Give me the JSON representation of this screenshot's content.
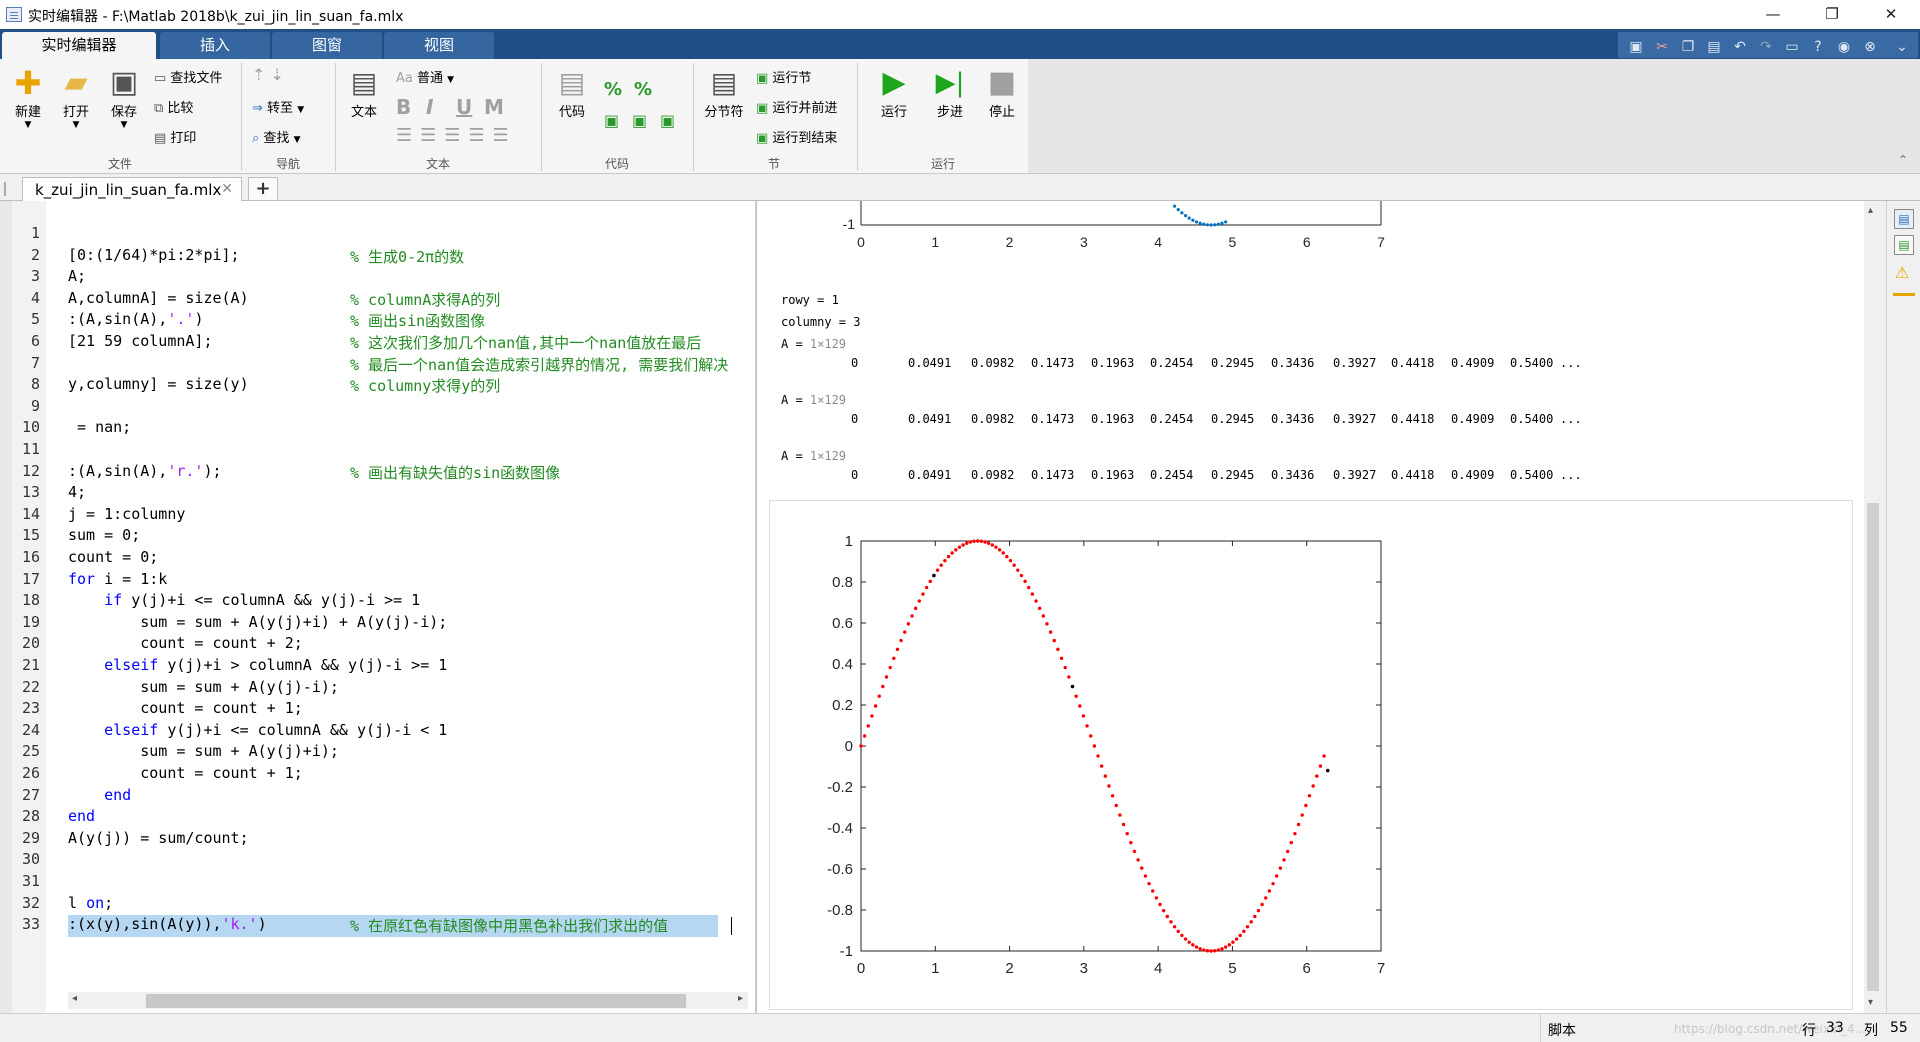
{
  "window": {
    "title": "实时编辑器 - F:\\Matlab 2018b\\k_zui_jin_lin_suan_fa.mlx",
    "minimize": "—",
    "restore": "❐",
    "close": "✕"
  },
  "ribbon_tabs": [
    {
      "label": "实时编辑器",
      "active": true
    },
    {
      "label": "插入",
      "active": false
    },
    {
      "label": "图窗",
      "active": false
    },
    {
      "label": "视图",
      "active": false
    }
  ],
  "ribbon": {
    "file": {
      "new": "新建",
      "open": "打开",
      "save": "保存",
      "find_files": "查找文件",
      "compare": "比较",
      "print": "打印",
      "group": "文件"
    },
    "navigate": {
      "goto": "转至",
      "find": "查找",
      "group": "导航"
    },
    "text": {
      "text_btn": "文本",
      "style": "普通",
      "bold": "B",
      "italic": "I",
      "underline": "U",
      "mono": "M",
      "group": "文本"
    },
    "code": {
      "code_btn": "代码",
      "group": "代码"
    },
    "section": {
      "break": "分节符",
      "run_section": "运行节",
      "run_advance": "运行并前进",
      "run_to_end": "运行到结束",
      "group": "节"
    },
    "run": {
      "run": "运行",
      "step": "步进",
      "stop": "停止",
      "group": "运行"
    }
  },
  "document_tab": {
    "name": "k_zui_jin_lin_suan_fa.mlx",
    "close": "✕",
    "add": "+"
  },
  "editor": {
    "lines": [
      {
        "n": "1",
        "html": ""
      },
      {
        "n": "2",
        "html": "[0:(1/64)*pi:2*pi];",
        "cmt": "% 生成0-2π的数"
      },
      {
        "n": "3",
        "html": "A;"
      },
      {
        "n": "4",
        "html": "A,columnA] = size(A)",
        "cmt": "% columnA求得A的列"
      },
      {
        "n": "5",
        "html": ":(A,sin(A),<s>'.'</s>)",
        "cmt": "% 画出sin函数图像"
      },
      {
        "n": "6",
        "html": "[21 59 columnA];",
        "cmt": "% 这次我们多加几个nan值,其中一个nan值放在最后"
      },
      {
        "n": "7",
        "html": "",
        "cmt": "% 最后一个nan值会造成索引越界的情况, 需要我们解决"
      },
      {
        "n": "8",
        "html": "y,columny] = size(y)",
        "cmt": "% columny求得y的列"
      },
      {
        "n": "9",
        "html": ""
      },
      {
        "n": "10",
        "html": " = nan;"
      },
      {
        "n": "11",
        "html": ""
      },
      {
        "n": "12",
        "html": ":(A,sin(A),<s>'r.'</s>);",
        "cmt": "% 画出有缺失值的sin函数图像"
      },
      {
        "n": "13",
        "html": "4;"
      },
      {
        "n": "14",
        "html": "j = 1:columny"
      },
      {
        "n": "15",
        "html": "sum = 0;"
      },
      {
        "n": "16",
        "html": "count = 0;"
      },
      {
        "n": "17",
        "html": "<k>for</k> i = 1:k"
      },
      {
        "n": "18",
        "html": "    <k>if</k> y(j)+i <= columnA && y(j)-i >= 1"
      },
      {
        "n": "19",
        "html": "        sum = sum + A(y(j)+i) + A(y(j)-i);"
      },
      {
        "n": "20",
        "html": "        count = count + 2;"
      },
      {
        "n": "21",
        "html": "    <k>elseif</k> y(j)+i > columnA && y(j)-i >= 1"
      },
      {
        "n": "22",
        "html": "        sum = sum + A(y(j)-i);"
      },
      {
        "n": "23",
        "html": "        count = count + 1;"
      },
      {
        "n": "24",
        "html": "    <k>elseif</k> y(j)+i <= columnA && y(j)-i < 1"
      },
      {
        "n": "25",
        "html": "        sum = sum + A(y(j)+i);"
      },
      {
        "n": "26",
        "html": "        count = count + 1;"
      },
      {
        "n": "27",
        "html": "    <k>end</k>"
      },
      {
        "n": "28",
        "html": "<k>end</k>"
      },
      {
        "n": "29",
        "html": "A(y(j)) = sum/count;"
      },
      {
        "n": "30",
        "html": ""
      },
      {
        "n": "31",
        "html": ""
      },
      {
        "n": "32",
        "html": "l <k>on</k>;"
      },
      {
        "n": "33",
        "html": ":(x(y),sin(A(y)),<s>'k.'</s>)",
        "cmt": "% 在原红色有缺图像中用黑色补出我们求出的值",
        "highlight": true
      }
    ]
  },
  "output": {
    "top_plot": {
      "ytick": "-1",
      "xticks": [
        "0",
        "1",
        "2",
        "3",
        "4",
        "5",
        "6",
        "7"
      ]
    },
    "rowy": "rowy = 1",
    "columny": "columny = 3",
    "arrays": [
      {
        "label": "A =",
        "size": "1×129",
        "values": [
          "0",
          "0.0491",
          "0.0982",
          "0.1473",
          "0.1963",
          "0.2454",
          "0.2945",
          "0.3436",
          "0.3927",
          "0.4418",
          "0.4909",
          "0.5400",
          "..."
        ]
      },
      {
        "label": "A =",
        "size": "1×129",
        "values": [
          "0",
          "0.0491",
          "0.0982",
          "0.1473",
          "0.1963",
          "0.2454",
          "0.2945",
          "0.3436",
          "0.3927",
          "0.4418",
          "0.4909",
          "0.5400",
          "..."
        ]
      },
      {
        "label": "A =",
        "size": "1×129",
        "values": [
          "0",
          "0.0491",
          "0.0982",
          "0.1473",
          "0.1963",
          "0.2454",
          "0.2945",
          "0.3436",
          "0.3927",
          "0.4418",
          "0.4909",
          "0.5400",
          "..."
        ]
      }
    ],
    "main_plot": {
      "xlim": [
        0,
        7
      ],
      "ylim": [
        -1,
        1
      ],
      "xticks": [
        "0",
        "1",
        "2",
        "3",
        "4",
        "5",
        "6",
        "7"
      ],
      "yticks": [
        "1",
        "0.8",
        "0.6",
        "0.4",
        "0.2",
        "0",
        "-0.2",
        "-0.4",
        "-0.6",
        "-0.8",
        "-1"
      ],
      "red_color": "#ff0000",
      "black_color": "#000000"
    }
  },
  "status": {
    "mode": "脚本",
    "watermark": "https://blog.csdn.net/weixin_4...",
    "row_label": "行",
    "row": "33",
    "col_label": "列",
    "col": "55"
  }
}
